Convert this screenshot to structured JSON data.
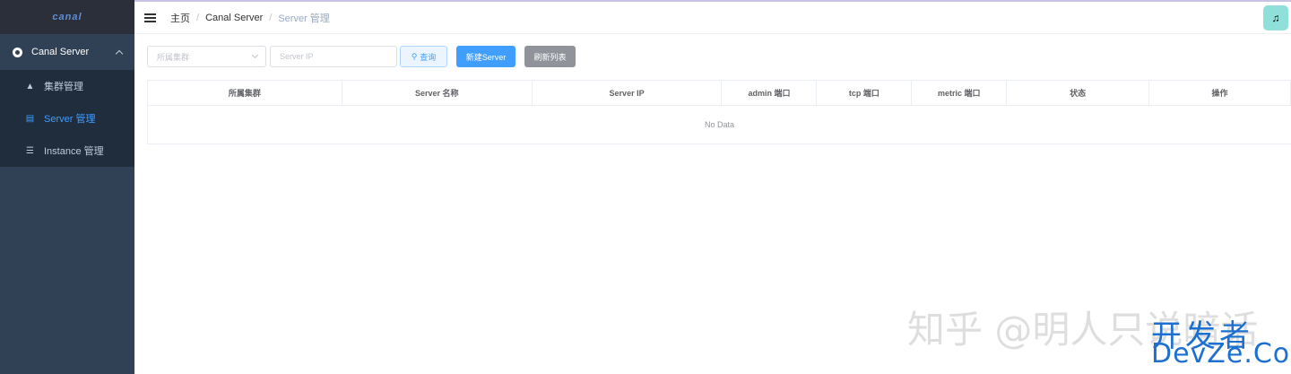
{
  "sidebar": {
    "logo": "canal",
    "root": {
      "label": "Canal Server"
    },
    "items": [
      {
        "label": "集群管理",
        "icon": "cluster-icon"
      },
      {
        "label": "Server 管理",
        "icon": "server-icon",
        "active": true
      },
      {
        "label": "Instance 管理",
        "icon": "list-icon"
      }
    ]
  },
  "header": {
    "breadcrumbs": [
      "主页",
      "Canal Server",
      "Server 管理"
    ],
    "avatar_icon": "user-avatar"
  },
  "filters": {
    "cluster_placeholder": "所属集群",
    "ip_placeholder": "Server IP",
    "search_label": "查询",
    "new_label": "新建Server",
    "refresh_label": "刷新列表"
  },
  "table": {
    "columns": [
      "所属集群",
      "Server 名称",
      "Server IP",
      "admin 端口",
      "tcp 端口",
      "metric 端口",
      "状态",
      "操作"
    ],
    "empty_text": "No Data"
  },
  "watermark": {
    "zhihu": "知乎 @明人只说暗话",
    "kaifazhe": "开发者",
    "devze": "DevZe.CoM"
  },
  "colors": {
    "sidebar_bg": "#304156",
    "submenu_bg": "#1f2d3d",
    "active": "#409eff",
    "button_primary": "#409eff",
    "button_info": "#909399"
  }
}
